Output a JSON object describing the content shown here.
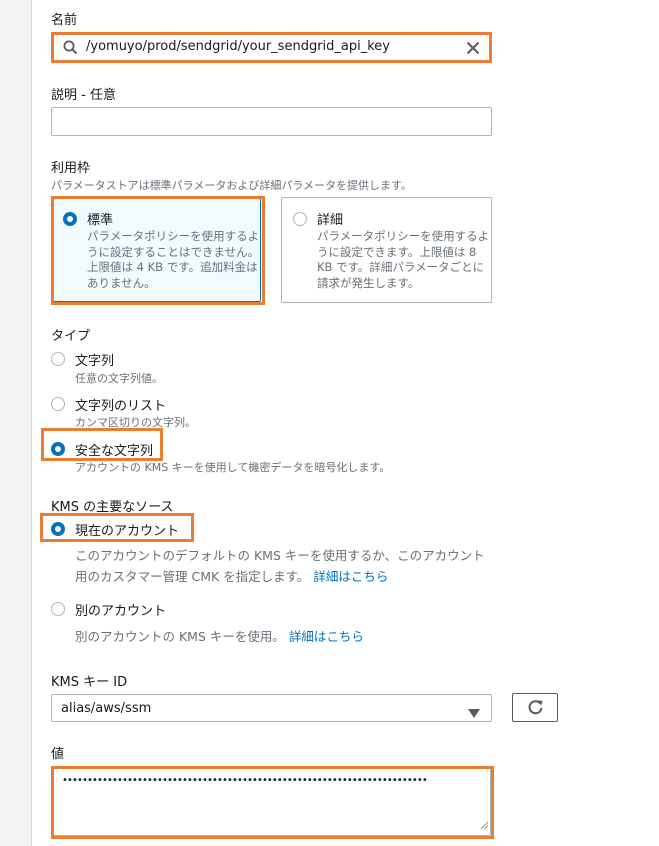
{
  "name_section": {
    "label": "名前",
    "value": "/yomuyo/prod/sendgrid/your_sendgrid_api_key"
  },
  "description_section": {
    "label": "説明 - 任意",
    "value": ""
  },
  "tier_section": {
    "label": "利用枠",
    "hint": "パラメータストアは標準パラメータおよび詳細パラメータを提供します。",
    "options": [
      {
        "title": "標準",
        "desc_lines": [
          "パラメータポリシーを使用するよ",
          "うに設定することはできません。",
          "上限値は 4 KB です。追加料金は",
          "ありません。"
        ],
        "selected": true
      },
      {
        "title": "詳細",
        "desc_lines": [
          "パラメータポリシーを使用するよ",
          "うに設定できます。上限値は 8",
          "KB です。詳細パラメータごとに",
          "請求が発生します。"
        ],
        "selected": false
      }
    ]
  },
  "type_section": {
    "label": "タイプ",
    "options": [
      {
        "label": "文字列",
        "desc": "任意の文字列値。",
        "selected": false
      },
      {
        "label": "文字列のリスト",
        "desc": "カンマ区切りの文字列。",
        "selected": false
      },
      {
        "label": "安全な文字列",
        "desc": "アカウントの KMS キーを使用して機密データを暗号化します。",
        "selected": true
      }
    ]
  },
  "kms_source_section": {
    "label": "KMS の主要なソース",
    "options": [
      {
        "label": "現在のアカウント",
        "desc_line1": "このアカウントのデフォルトの KMS キーを使用するか、このアカウント",
        "desc_line2": "用のカスタマー管理 CMK を指定します。",
        "link": "詳細はこちら",
        "selected": true
      },
      {
        "label": "別のアカウント",
        "desc_line1": "別のアカウントの KMS キーを使用。",
        "link": "詳細はこちら",
        "selected": false
      }
    ]
  },
  "kms_key_section": {
    "label": "KMS キー ID",
    "selected": "alias/aws/ssm"
  },
  "value_section": {
    "label": "値",
    "value": "•••••••••••••••••••••••••••••••••••••••••••••••••••••••••••••••••••••••••"
  },
  "icons": {
    "search": "search-icon",
    "clear": "close-icon",
    "dropdown": "caret-down-icon",
    "refresh": "refresh-icon"
  },
  "colors": {
    "highlight": "#ec7c30",
    "accent": "#0073bb",
    "selected_tile_bg": "#f1faff"
  }
}
